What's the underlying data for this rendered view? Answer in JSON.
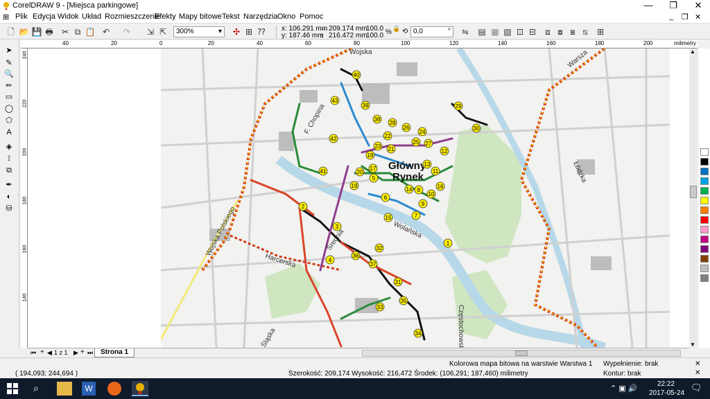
{
  "window": {
    "title": "CorelDRAW 9 - [Miejsca parkingowe]"
  },
  "menu": [
    "Plik",
    "Edycja",
    "Widok",
    "Układ",
    "Rozmieszczenie",
    "Efekty",
    "Mapy bitowe",
    "Tekst",
    "Narzędzia",
    "Okno",
    "Pomoc"
  ],
  "toolbar": {
    "zoom": "300%",
    "x": "x: 106.291 mm",
    "y": "y: 187.46 mm",
    "w": "209.174 mm",
    "h": "216.472 mm",
    "sx": "100.0",
    "sy": "100.0",
    "angle": "0,0",
    "unit_pct": "%",
    "deg": "°"
  },
  "ruler_top": {
    "unit": "milimetry",
    "ticks": [
      "40",
      "20",
      "0",
      "20",
      "40",
      "60",
      "80",
      "100",
      "120",
      "140",
      "160",
      "180",
      "200"
    ]
  },
  "ruler_left": {
    "unit": "milimetry",
    "ticks": [
      "240",
      "220",
      "200",
      "180",
      "160",
      "140"
    ]
  },
  "pages": {
    "count": "1 z 1",
    "tab": "Strona 1"
  },
  "status": {
    "cursor": "( 194,093; 244,694 )",
    "object": "Kolorowa mapa bitowa na warstwie Warstwa 1",
    "dims": "Szerokość: 209,174  Wysokość: 216,472  Środek: (106,291; 187,460)  milimetry",
    "fill": "Wypełnienie: brak",
    "outline": "Kontur: brak"
  },
  "map": {
    "labels": {
      "rynek1": "Główny",
      "rynek2": "Rynek",
      "woj_top": "Wojska",
      "warszawska": "Warsza",
      "chopina": "F. Chopina",
      "harcerska": "Harcerska",
      "wp": "Wojska Polskiego",
      "lodzka": "Łódzka",
      "czestochowska": "Częstochowska",
      "wolanska": "Wolańska",
      "sroda": "Średnia",
      "slaska": "Śląska"
    },
    "markers": [
      "1",
      "2",
      "3",
      "4",
      "5",
      "6",
      "7",
      "8",
      "9",
      "10",
      "11",
      "12",
      "13",
      "14",
      "15",
      "16",
      "17",
      "18",
      "19",
      "20",
      "21",
      "22",
      "23",
      "24",
      "25",
      "26",
      "27",
      "28",
      "29",
      "30",
      "31",
      "32",
      "33",
      "34",
      "35",
      "36",
      "37",
      "38",
      "39",
      "40",
      "41",
      "42",
      "43"
    ]
  },
  "palette_colors": [
    "#ffffff",
    "#000000",
    "#0070c0",
    "#00a0e0",
    "#00b050",
    "#ffff00",
    "#ff8000",
    "#ff0000",
    "#ff99cc",
    "#c00080",
    "#800080",
    "#804000",
    "#c0c0c0",
    "#808080"
  ],
  "taskbar": {
    "time": "22:22",
    "date": "2017-05-24"
  }
}
